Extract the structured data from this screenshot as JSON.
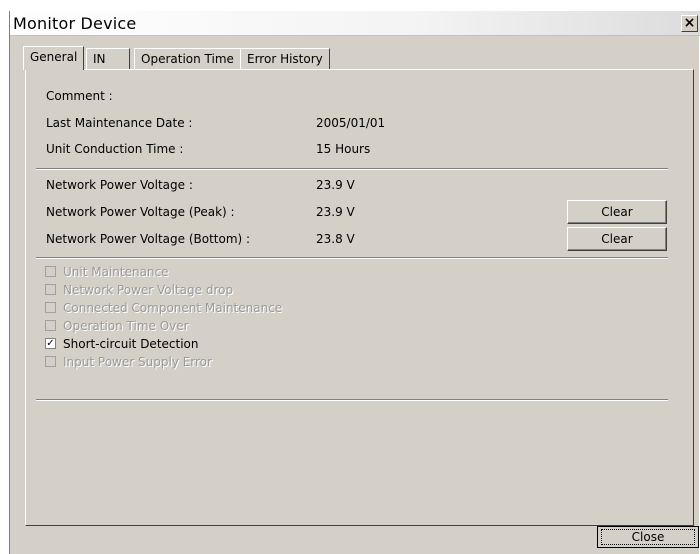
{
  "window": {
    "title": "Monitor Device",
    "close_glyph": "×"
  },
  "tabs": [
    {
      "label": "General",
      "active": true
    },
    {
      "label": "IN",
      "active": false
    },
    {
      "label": "Operation Time",
      "active": false
    },
    {
      "label": "Error History",
      "active": false
    }
  ],
  "info": {
    "comment_label": "Comment :",
    "last_maintenance_label": "Last Maintenance Date :",
    "last_maintenance_value": "2005/01/01",
    "conduction_label": "Unit Conduction Time :",
    "conduction_value": "15 Hours"
  },
  "voltage": {
    "network_label": "Network Power Voltage :",
    "network_value": "23.9 V",
    "peak_label": "Network Power Voltage (Peak) :",
    "peak_value": "23.9 V",
    "peak_clear": "Clear",
    "bottom_label": "Network Power Voltage (Bottom) :",
    "bottom_value": "23.8 V",
    "bottom_clear": "Clear"
  },
  "checks": [
    {
      "label": "Unit Maintenance",
      "checked": false,
      "enabled": false
    },
    {
      "label": "Network Power Voltage drop",
      "checked": false,
      "enabled": false
    },
    {
      "label": "Connected Component Maintenance",
      "checked": false,
      "enabled": false
    },
    {
      "label": "Operation Time Over",
      "checked": false,
      "enabled": false
    },
    {
      "label": "Short-circuit Detection",
      "checked": true,
      "enabled": true
    },
    {
      "label": "Input Power Supply Error",
      "checked": false,
      "enabled": false
    }
  ],
  "footer": {
    "close_label": "Close"
  },
  "colors": {
    "face": "#d4d0c8",
    "disabled_text": "#9a9a9a"
  }
}
